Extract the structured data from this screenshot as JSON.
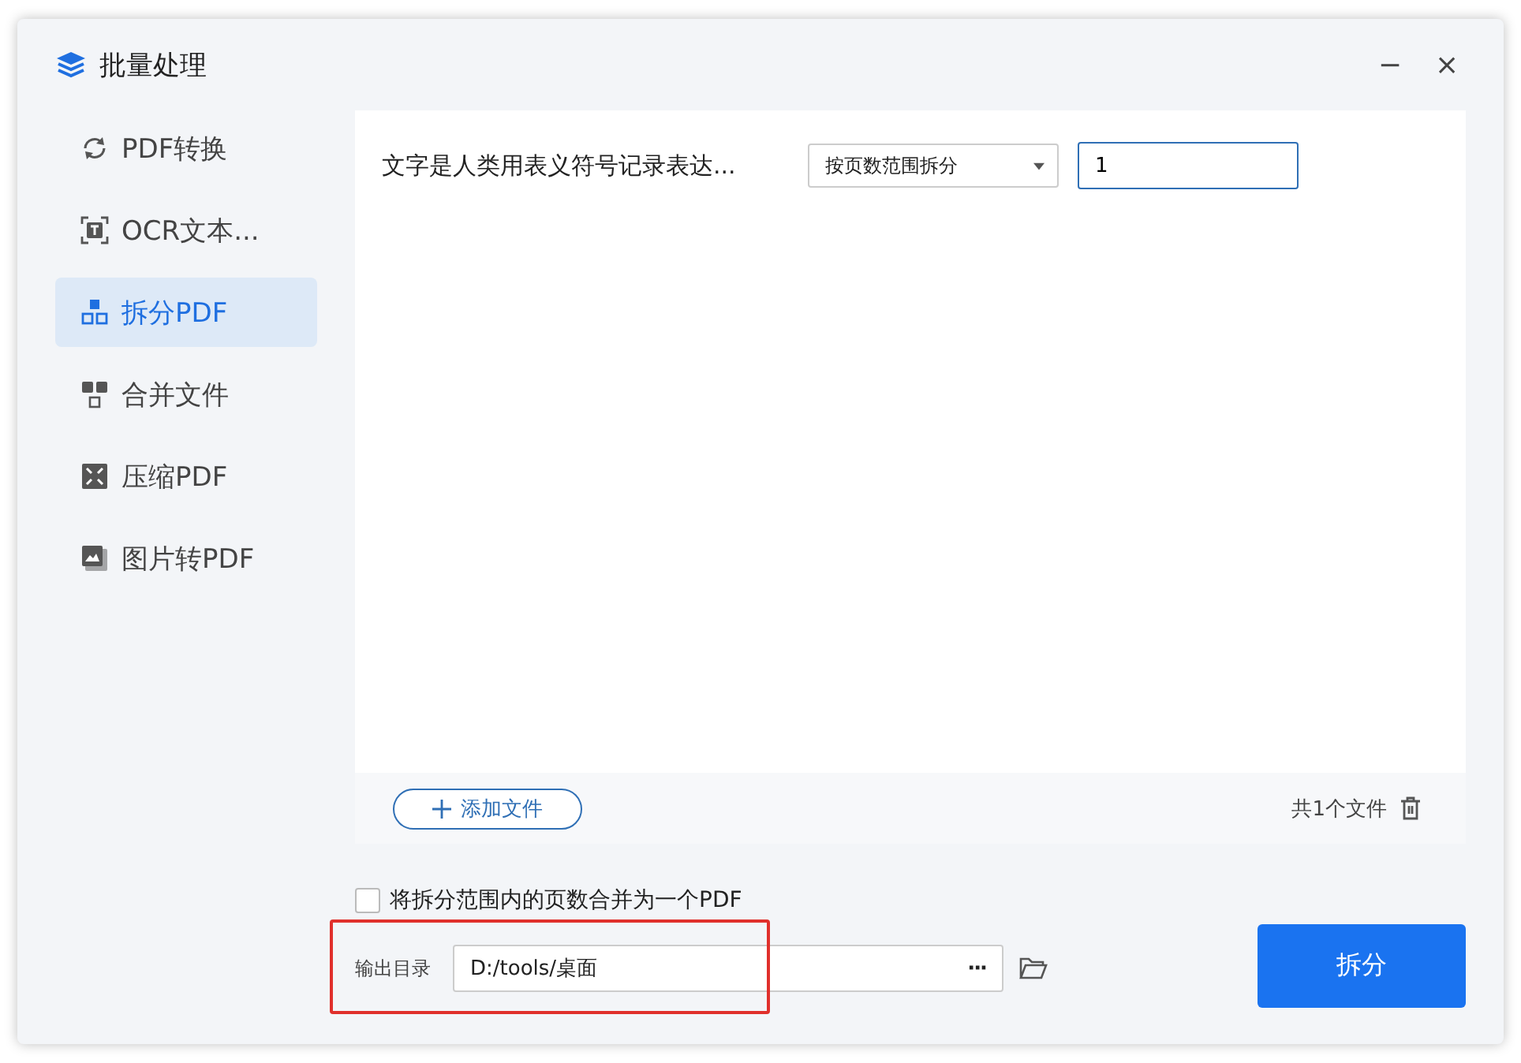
{
  "window": {
    "title": "批量处理",
    "controls": [
      "−",
      "×"
    ]
  },
  "sidebar": {
    "items": [
      {
        "label": "PDF转换",
        "selected": false
      },
      {
        "label": "OCR文本...",
        "selected": false
      },
      {
        "label": "拆分PDF",
        "selected": true
      },
      {
        "label": "合并文件",
        "selected": false
      },
      {
        "label": "压缩PDF",
        "selected": false
      },
      {
        "label": "图片转PDF",
        "selected": false
      }
    ]
  },
  "files": [
    {
      "name": "文字是人类用表义符号记录表达...",
      "mode": "按页数范围拆分",
      "pages": "1"
    }
  ],
  "footer": {
    "add_button": "添加文件",
    "count": "共1个文件"
  },
  "merge_option": {
    "label": "将拆分范围内的页数合并为一个PDF",
    "checked": false
  },
  "output": {
    "label": "输出目录",
    "path": "D:/tools/桌面",
    "more": "···",
    "highlighted": true
  },
  "action_button": "拆分"
}
